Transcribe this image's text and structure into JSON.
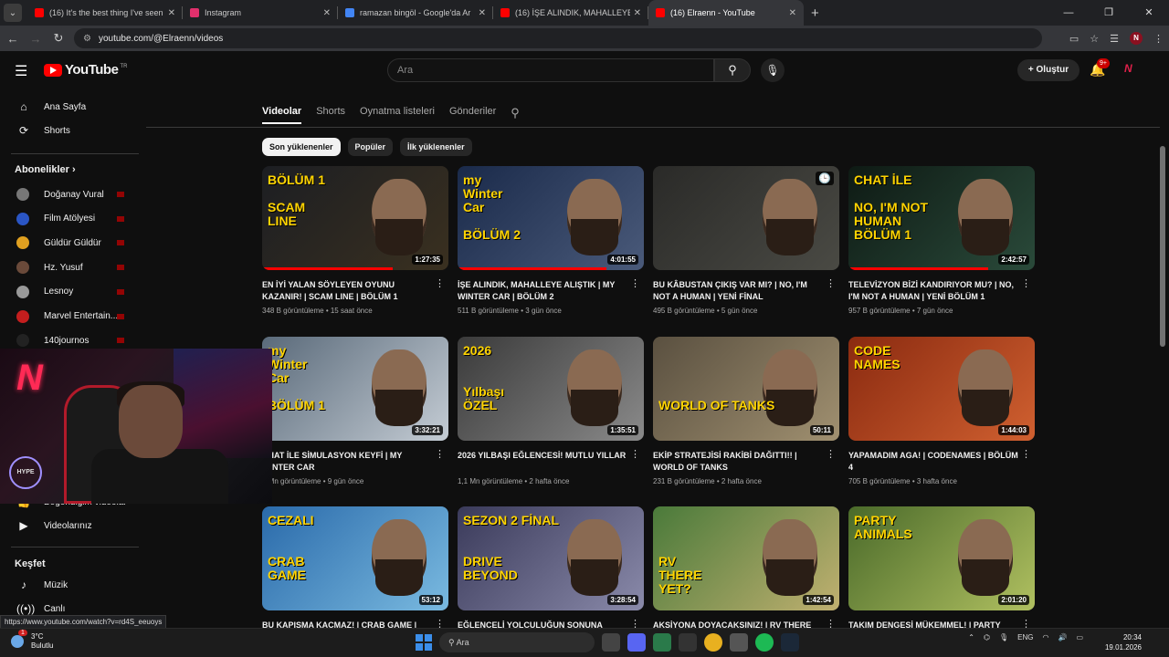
{
  "browser": {
    "tabs": [
      {
        "title": "(16) It's the best thing I've seen",
        "fav": "#ff0000"
      },
      {
        "title": "Instagram",
        "fav": "#e1306c"
      },
      {
        "title": "ramazan bingöl - Google'da Ar",
        "fav": "#4285f4"
      },
      {
        "title": "(16) İŞE ALINDIK, MAHALLEYE A",
        "fav": "#ff0000"
      },
      {
        "title": "(16) Elraenn - YouTube",
        "fav": "#ff0000"
      }
    ],
    "url": "youtube.com/@Elraenn/videos"
  },
  "header": {
    "logo_text": "YouTube",
    "logo_country": "TR",
    "search_placeholder": "Ara",
    "create_label": "Oluştur",
    "notif_count": "9+"
  },
  "sidebar": {
    "home": "Ana Sayfa",
    "shorts": "Shorts",
    "subs_heading": "Abonelikler",
    "subs": [
      {
        "name": "Doğanay Vural",
        "color": "#777"
      },
      {
        "name": "Film Atölyesi",
        "color": "#2a55c4"
      },
      {
        "name": "Güldür Güldür",
        "color": "#e0a020"
      },
      {
        "name": "Hz. Yusuf",
        "color": "#6a4a3a"
      },
      {
        "name": "Lesnoy",
        "color": "#999"
      },
      {
        "name": "Marvel Entertain...",
        "color": "#c41e1e"
      },
      {
        "name": "140journos",
        "color": "#222"
      }
    ],
    "partial_item": "Beğendiğim videolar",
    "your_videos": "Videolarınız",
    "explore_heading": "Keşfet",
    "music": "Müzik",
    "live": "Canlı"
  },
  "webcam": {
    "logo": "N",
    "badge": "HYPE"
  },
  "channel_tabs": [
    "Ana Sayfa",
    "Videolar",
    "Shorts",
    "Oynatma listeleri",
    "Gönderiler"
  ],
  "chips": [
    "Son yüklenenler",
    "Popüler",
    "İlk yüklenenler"
  ],
  "videos": [
    {
      "title": "EN İYİ YALAN SÖYLEYEN OYUNU KAZANIR! | SCAM LINE | BÖLÜM 1",
      "views": "348 B görüntüleme",
      "age": "15 saat önce",
      "dur": "1:27:35",
      "bg1": "#1c1e22",
      "bg2": "#3a3020",
      "thumb_text": "BÖLÜM 1\n\nSCAM\nLINE"
    },
    {
      "title": "İŞE ALINDIK, MAHALLEYE ALIŞTIK | MY WINTER CAR | BÖLÜM 2",
      "views": "511 B görüntüleme",
      "age": "3 gün önce",
      "dur": "4:01:55",
      "bg1": "#1a2a4a",
      "bg2": "#4a5a7a",
      "thumb_text": "my\nWinter\nCar\n\nBÖLÜM 2"
    },
    {
      "title": "BU KÂBUSTAN ÇIKIŞ VAR MI? | NO, I'M NOT A HUMAN | YENİ FİNAL",
      "views": "495 B görüntüleme",
      "age": "5 gün önce",
      "dur": "",
      "bg1": "#2a2a28",
      "bg2": "#4a4a44",
      "thumb_text": ""
    },
    {
      "title": "TELEVİZYON BİZİ KANDIRIYOR MU? | NO, I'M NOT A HUMAN | YENİ BÖLÜM 1",
      "views": "957 B görüntüleme",
      "age": "7 gün önce",
      "dur": "2:42:57",
      "bg1": "#0e1a14",
      "bg2": "#2a4a3a",
      "thumb_text": "CHAT İLE\n\nNO, I'M NOT\nHUMAN\nBÖLÜM 1"
    },
    {
      "title": "CHAT İLE SİMULASYON KEYFİ | MY WINTER CAR",
      "views": "1 Mn görüntüleme",
      "age": "9 gün önce",
      "dur": "3:32:21",
      "bg1": "#5a6a7a",
      "bg2": "#c4ccd4",
      "thumb_text": "my\nWinter\nCar\n\nBÖLÜM 1"
    },
    {
      "title": "2026 YILBAŞI EĞLENCESİ! MUTLU YILLAR",
      "views": "1,1 Mn görüntüleme",
      "age": "2 hafta önce",
      "dur": "1:35:51",
      "bg1": "#3a3a3a",
      "bg2": "#8a8a8a",
      "thumb_text": "2026\n\n\nYılbaşı\nÖZEL"
    },
    {
      "title": "EKİP STRATEJİSİ RAKİBİ DAĞITTI!! | WORLD OF TANKS",
      "views": "231 B görüntüleme",
      "age": "2 hafta önce",
      "dur": "50:11",
      "bg1": "#5a5040",
      "bg2": "#a09070",
      "thumb_text": "\n\n\n\nWORLD OF TANKS"
    },
    {
      "title": "YAPAMADIM AGA! | CODENAMES | BÖLÜM 4",
      "views": "705 B görüntüleme",
      "age": "3 hafta önce",
      "dur": "1:44:03",
      "bg1": "#8a2a10",
      "bg2": "#d06030",
      "thumb_text": "CODE\nNAMES"
    },
    {
      "title": "BU KAPIŞMA KAÇMAZ! | CRAB GAME |",
      "views": "",
      "age": "",
      "dur": "53:12",
      "bg1": "#2a6aaa",
      "bg2": "#7abae0",
      "thumb_text": "CEZALI\n\n\nCRAB\nGAME"
    },
    {
      "title": "EĞLENCELİ YOLCULUĞUN SONUNA GELDİK |",
      "views": "",
      "age": "",
      "dur": "3:28:54",
      "bg1": "#3a3a5a",
      "bg2": "#8a8aaa",
      "thumb_text": "SEZON 2  FİNAL\n\n\nDRIVE\nBEYOND"
    },
    {
      "title": "AKSİYONA DOYACAKSINIZ! | RV THERE",
      "views": "",
      "age": "",
      "dur": "1:42:54",
      "bg1": "#4a7a3a",
      "bg2": "#c0b070",
      "thumb_text": "\n\n\nRV\nTHERE\nYET?"
    },
    {
      "title": "TAKIM DENGESİ MÜKEMMEL! | PARTY",
      "views": "",
      "age": "",
      "dur": "2:01:20",
      "bg1": "#4a6a2a",
      "bg2": "#b0c060",
      "thumb_text": "PARTY\nANIMALS"
    }
  ],
  "status_url": "https://www.youtube.com/watch?v=rd4S_eeuoys",
  "taskbar": {
    "weather_temp": "3°C",
    "weather_desc": "Bulutlu",
    "weather_badge": "1",
    "search": "Ara",
    "lang": "ENG",
    "time": "20:34",
    "date": "19.01.2026"
  }
}
